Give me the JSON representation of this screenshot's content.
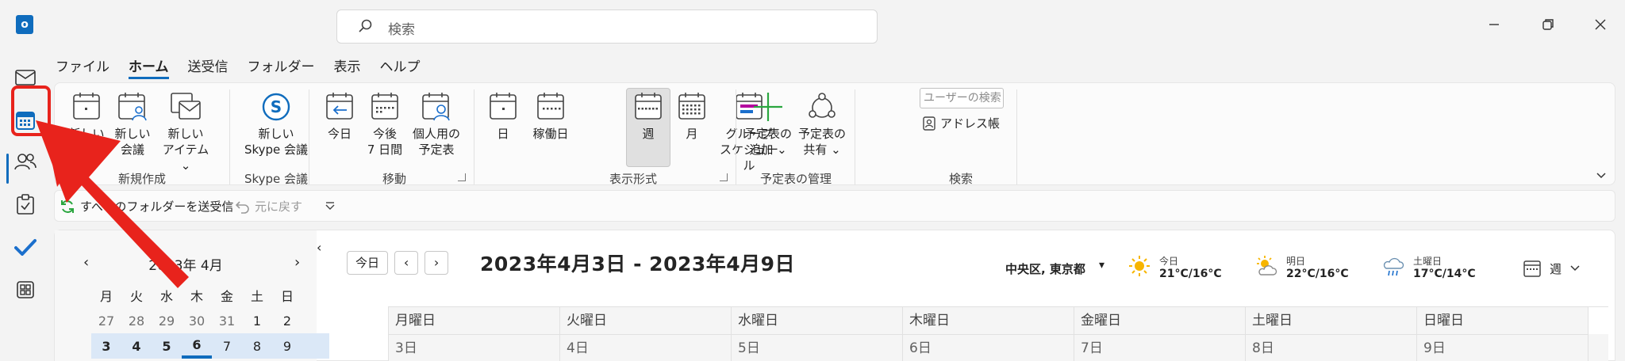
{
  "search": {
    "placeholder": "検索"
  },
  "menu": {
    "tabs": [
      "ファイル",
      "ホーム",
      "送受信",
      "フォルダー",
      "表示",
      "ヘルプ"
    ],
    "active_index": 1
  },
  "ribbon": {
    "new_group": {
      "label": "新規作成",
      "buttons": [
        {
          "line1": "新しい",
          "line2": "予定"
        },
        {
          "line1": "新しい",
          "line2": "会議"
        },
        {
          "line1": "新しい",
          "line2": "アイテム ⌄"
        }
      ]
    },
    "skype_group": {
      "label": "Skype 会議",
      "button": {
        "line1": "新しい",
        "line2": "Skype 会議"
      }
    },
    "move_group": {
      "label": "移動",
      "buttons": [
        {
          "line1": "今日",
          "line2": ""
        },
        {
          "line1": "今後",
          "line2": "7 日間"
        },
        {
          "line1": "個人用の",
          "line2": "予定表"
        }
      ]
    },
    "view_group": {
      "label": "表示形式",
      "buttons": [
        {
          "line1": "日",
          "line2": ""
        },
        {
          "line1": "稼働日",
          "line2": ""
        },
        {
          "line1": "週",
          "line2": ""
        },
        {
          "line1": "月",
          "line2": ""
        },
        {
          "line1": "グループ",
          "line2": "スケジュール"
        }
      ],
      "selected": "週"
    },
    "manage_group": {
      "label": "予定表の管理",
      "buttons": [
        {
          "line1": "予定表の",
          "line2": "追加 ⌄"
        },
        {
          "line1": "予定表の",
          "line2": "共有 ⌄"
        }
      ]
    },
    "search_group": {
      "label": "検索",
      "user_search_placeholder": "ユーザーの検索",
      "address_book": "アドレス帳"
    }
  },
  "qat": {
    "send_receive": "すべてのフォルダーを送受信",
    "undo": "元に戻す"
  },
  "mini_calendar": {
    "month_label": "2023年 4月",
    "weekday_headers": [
      "月",
      "火",
      "水",
      "木",
      "金",
      "土",
      "日"
    ],
    "rows": [
      [
        "27",
        "28",
        "29",
        "30",
        "31",
        "1",
        "2"
      ],
      [
        "3",
        "4",
        "5",
        "6",
        "7",
        "8",
        "9"
      ]
    ]
  },
  "calendar": {
    "today_button": "今日",
    "range_title": "2023年4月3日 - 2023年4月9日",
    "location": "中央区, 東京都",
    "weather": [
      {
        "label": "今日",
        "temp": "21°C/16°C",
        "icon": "sunny-icon"
      },
      {
        "label": "明日",
        "temp": "22°C/16°C",
        "icon": "partly-sunny-icon"
      },
      {
        "label": "土曜日",
        "temp": "17°C/14°C",
        "icon": "rain-icon"
      }
    ],
    "view_label": "週",
    "week_headers": [
      "月曜日",
      "火曜日",
      "水曜日",
      "木曜日",
      "金曜日",
      "土曜日",
      "日曜日"
    ],
    "week_dates": [
      "3日",
      "4日",
      "5日",
      "6日",
      "7日",
      "8日",
      "9日"
    ]
  },
  "colors": {
    "accent": "#0f6cbd",
    "annotation": "#e8231c"
  }
}
